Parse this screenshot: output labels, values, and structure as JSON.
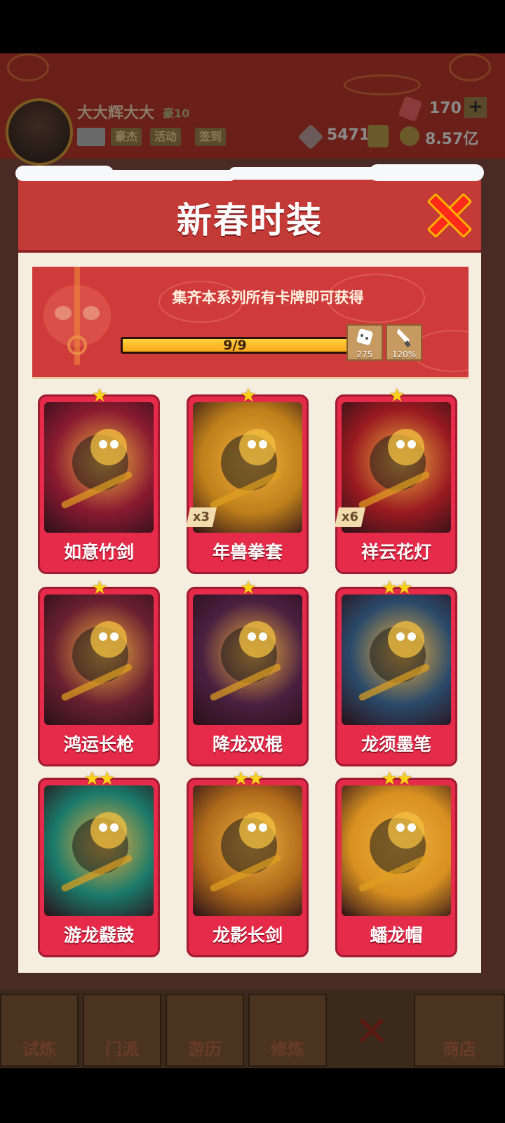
{
  "game": {
    "player": {
      "name": "大大辉大大",
      "rank": "豪10"
    },
    "buttons": [
      "豪杰",
      "活动",
      "签到"
    ],
    "resources": {
      "gems": "170",
      "tokens": "5471",
      "gold": "8.57亿"
    },
    "nav": [
      "试炼",
      "门派",
      "游历",
      "修炼",
      "商店"
    ]
  },
  "modal": {
    "title": "新春时装",
    "banner_text": "集齐本系列所有卡牌即可获得",
    "progress": {
      "text": "9/9",
      "fraction": 1.0
    },
    "rewards": [
      {
        "icon": "dice-icon",
        "value": "275"
      },
      {
        "icon": "blade-icon",
        "value": "120%"
      }
    ],
    "cards": [
      {
        "name": "如意竹剑",
        "stars": "★",
        "count": "",
        "bg": "#8a1a30"
      },
      {
        "name": "年兽拳套",
        "stars": "★",
        "count": "x3",
        "bg": "#c0801a"
      },
      {
        "name": "祥云花灯",
        "stars": "★",
        "count": "x6",
        "bg": "#9a1a20"
      },
      {
        "name": "鸿运长枪",
        "stars": "★",
        "count": "",
        "bg": "#6a2030"
      },
      {
        "name": "降龙双棍",
        "stars": "★",
        "count": "",
        "bg": "#4a2040"
      },
      {
        "name": "龙须墨笔",
        "stars": "★★",
        "count": "",
        "bg": "#2a4a6a"
      },
      {
        "name": "游龙鼗鼓",
        "stars": "★★",
        "count": "",
        "bg": "#1a7a6a"
      },
      {
        "name": "龙影长剑",
        "stars": "★★",
        "count": "",
        "bg": "#b06a1a"
      },
      {
        "name": "蟠龙帽",
        "stars": "★★",
        "count": "",
        "bg": "#d89020"
      }
    ]
  }
}
